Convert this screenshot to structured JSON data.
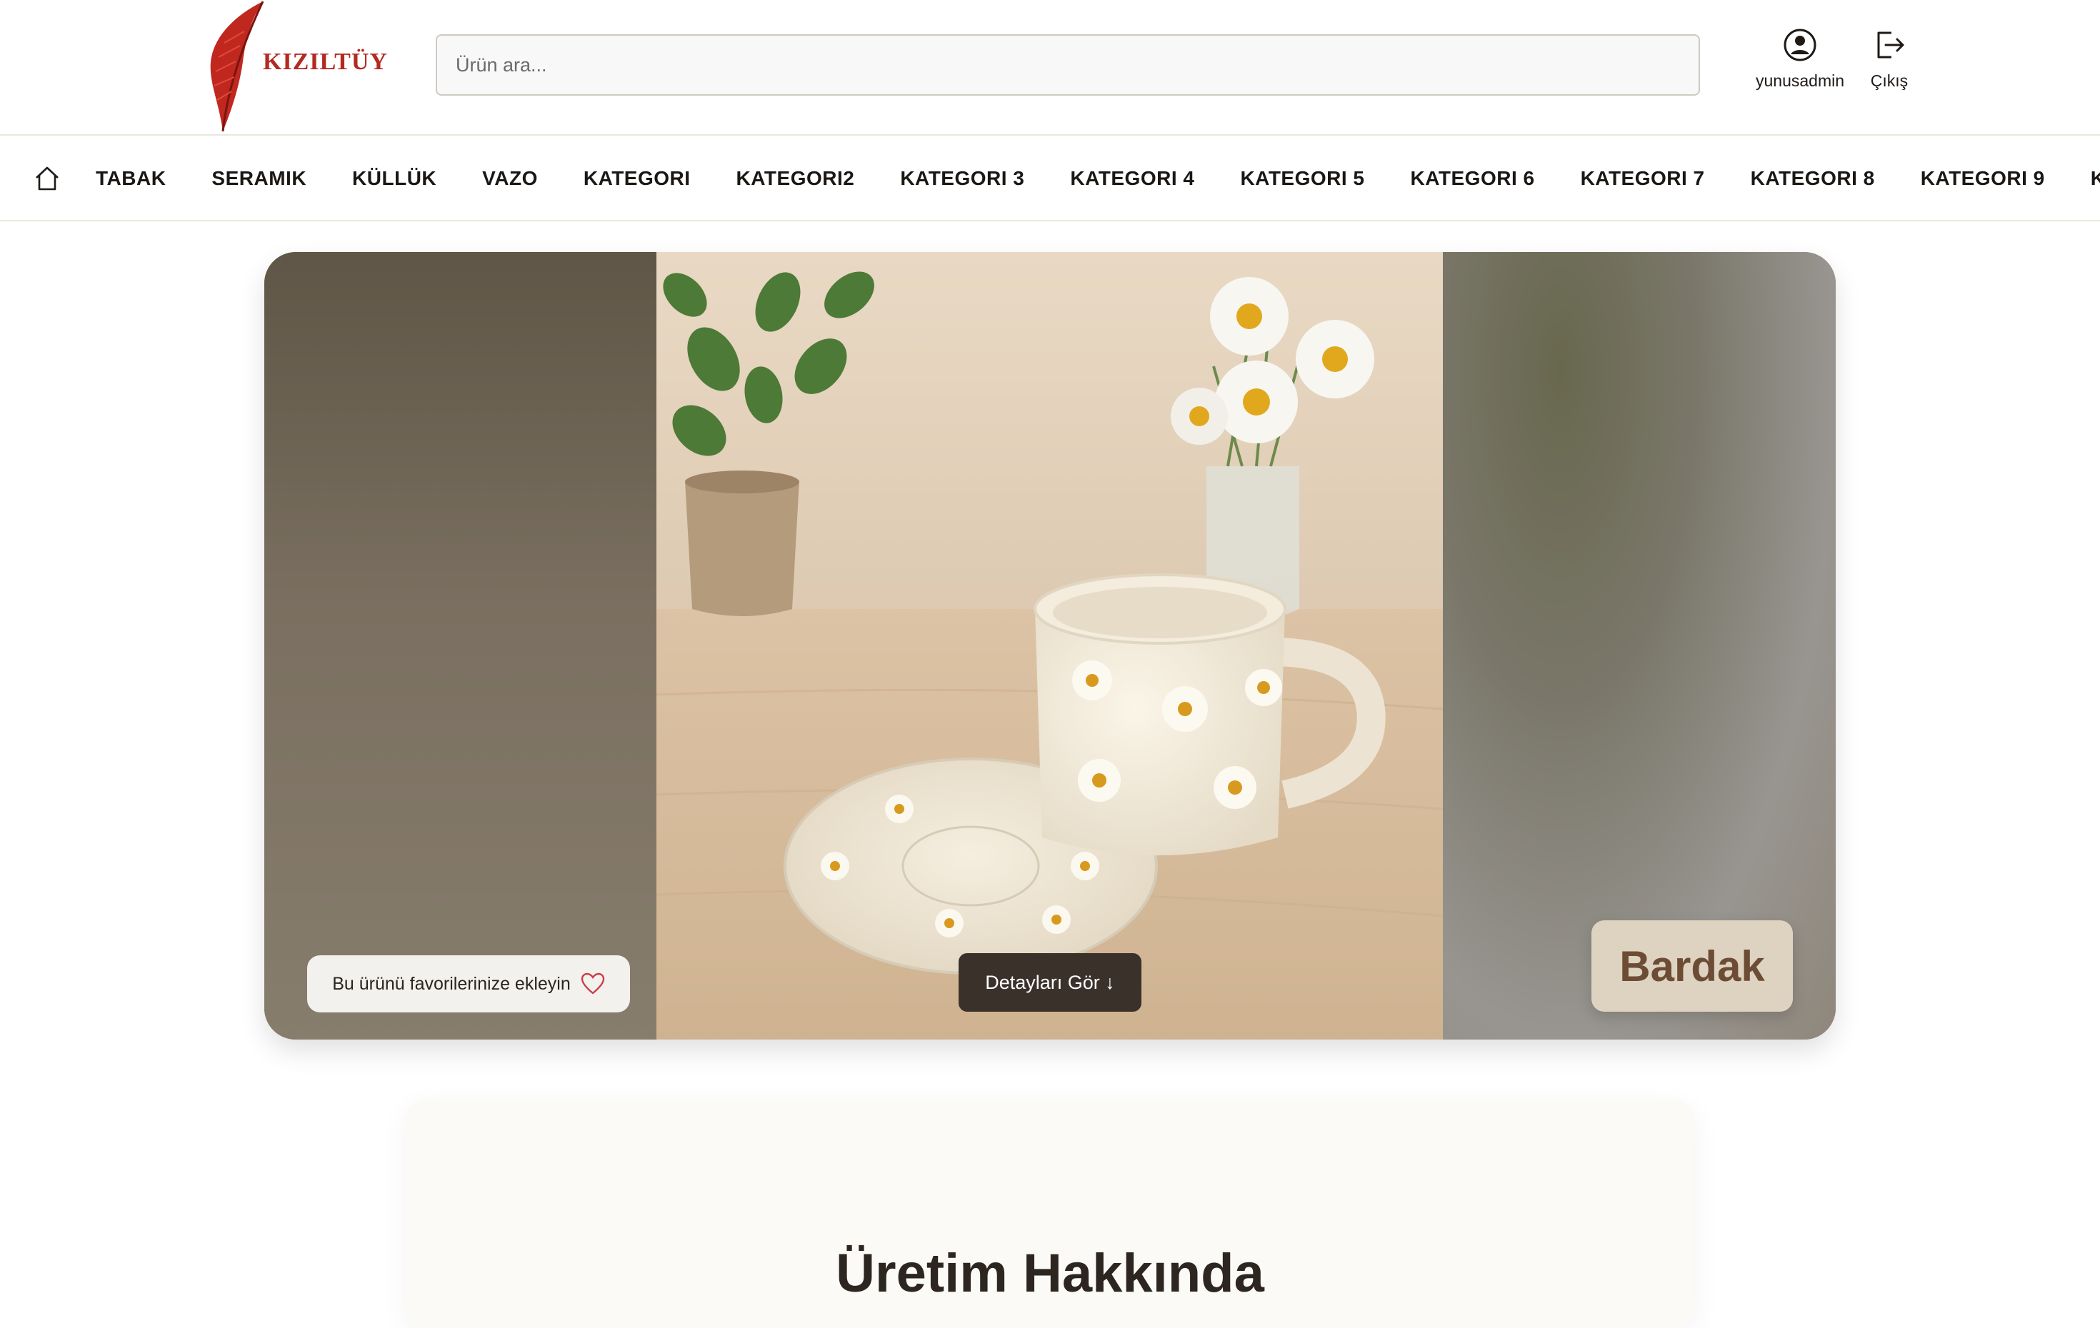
{
  "brand": {
    "name": "KIZILTÜY",
    "color": "#b22a22"
  },
  "search": {
    "placeholder": "Ürün ara..."
  },
  "header_actions": {
    "user": {
      "label": "yunusadmin",
      "icon": "user-circle-icon"
    },
    "logout": {
      "label": "Çıkış",
      "icon": "logout-icon"
    }
  },
  "nav": {
    "home_icon": "home-icon",
    "items": [
      "TABAK",
      "SERAMIK",
      "KÜLLÜK",
      "VAZO",
      "KATEGORI",
      "KATEGORI2",
      "KATEGORI 3",
      "KATEGORI 4",
      "KATEGORI 5",
      "KATEGORI 6",
      "KATEGORI 7",
      "KATEGORI 8",
      "KATEGORI 9",
      "KATEGORI"
    ]
  },
  "hero": {
    "favorite_label": "Bu ürünü favorilerinize ekleyin",
    "favorite_icon": "heart-icon",
    "details_label": "Detayları Gör ↓",
    "product_name": "Bardak"
  },
  "about": {
    "title": "Üretim Hakkında"
  },
  "colors": {
    "accent_dark": "#3a312a",
    "badge_bg": "#ddd3c0",
    "badge_text": "#6d4c35"
  }
}
